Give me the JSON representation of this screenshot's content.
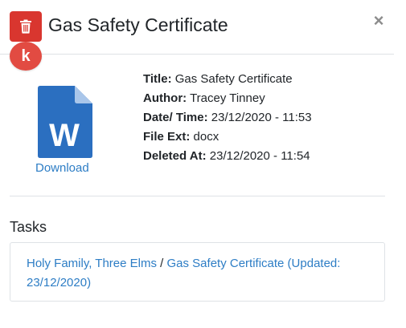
{
  "modal": {
    "title": "Gas Safety Certificate",
    "close_symbol": "×",
    "avatar_letter": "k",
    "icons": {
      "trash": "trash-icon",
      "document": "word-document-icon",
      "close": "close-icon"
    },
    "colors": {
      "trash_bg": "#d9362f",
      "avatar_bg": "#e24b42",
      "link": "#2d7dc5",
      "word_blue": "#2b6fc0"
    }
  },
  "file": {
    "download_label": "Download",
    "doc_letter": "W",
    "meta": [
      {
        "label": "Title:",
        "value": "Gas Safety Certificate"
      },
      {
        "label": "Author:",
        "value": "Tracey Tinney"
      },
      {
        "label": "Date/ Time:",
        "value": "23/12/2020 - 11:53"
      },
      {
        "label": "File Ext:",
        "value": "docx"
      },
      {
        "label": "Deleted At:",
        "value": "23/12/2020 - 11:54"
      }
    ]
  },
  "tasks": {
    "heading": "Tasks",
    "items": [
      {
        "location": "Holy Family, Three Elms",
        "separator": " / ",
        "task": "Gas Safety Certificate (Updated: 23/12/2020)"
      }
    ]
  }
}
